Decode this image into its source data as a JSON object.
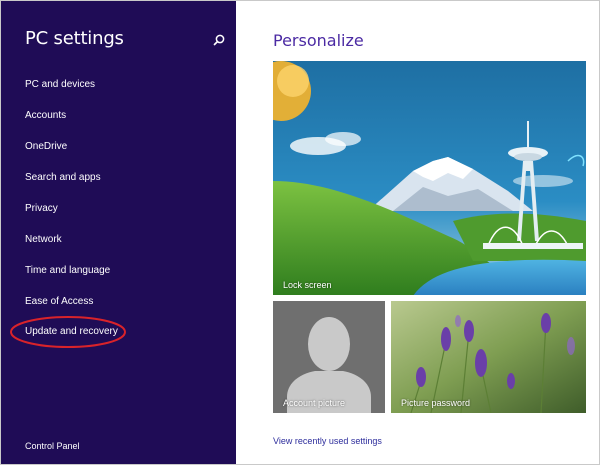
{
  "sidebar": {
    "title": "PC settings",
    "search_icon": "search-icon",
    "items": [
      {
        "label": "PC and devices"
      },
      {
        "label": "Accounts"
      },
      {
        "label": "OneDrive"
      },
      {
        "label": "Search and apps"
      },
      {
        "label": "Privacy"
      },
      {
        "label": "Network"
      },
      {
        "label": "Time and language"
      },
      {
        "label": "Ease of Access"
      },
      {
        "label": "Update and recovery",
        "highlighted": true
      }
    ],
    "footer_link": "Control Panel",
    "background_color": "#1f0c56",
    "highlight_color": "#d9232a"
  },
  "main": {
    "title": "Personalize",
    "title_color": "#4b2aa3",
    "tiles": [
      {
        "label": "Lock screen"
      },
      {
        "label": "Account picture"
      },
      {
        "label": "Picture password"
      }
    ],
    "recent_link": "View recently used settings"
  }
}
